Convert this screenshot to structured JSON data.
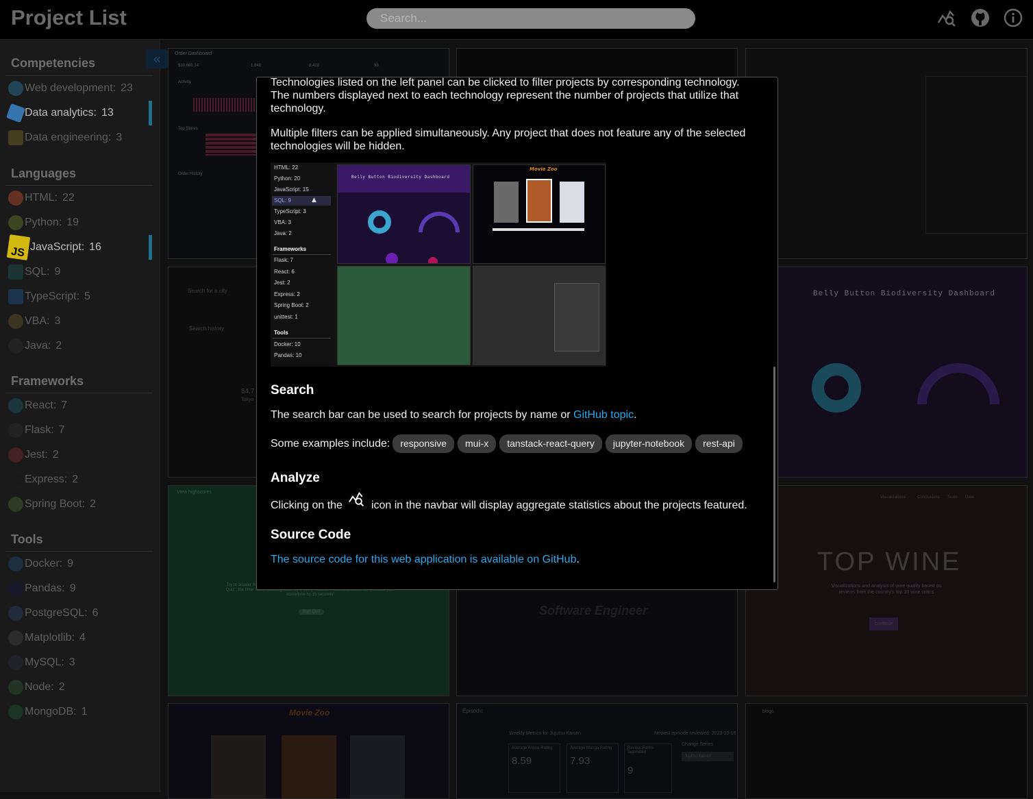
{
  "header": {
    "title": "Project List",
    "search_placeholder": "Search...",
    "icons": [
      "analytics-icon",
      "github-icon",
      "info-icon"
    ]
  },
  "sidebar": {
    "collapse_icon": "double-chevron-left-icon",
    "sections": [
      {
        "title": "Competencies",
        "items": [
          {
            "label": "Web development:",
            "count": "23"
          },
          {
            "label": "Data analytics:",
            "count": "13",
            "active": true
          },
          {
            "label": "Data engineering:",
            "count": "3"
          }
        ]
      },
      {
        "title": "Languages",
        "items": [
          {
            "label": "HTML:",
            "count": "22"
          },
          {
            "label": "Python:",
            "count": "19"
          },
          {
            "label": "JavaScript:",
            "count": "16",
            "active": true
          },
          {
            "label": "SQL:",
            "count": "9"
          },
          {
            "label": "TypeScript:",
            "count": "5"
          },
          {
            "label": "VBA:",
            "count": "3"
          },
          {
            "label": "Java:",
            "count": "2"
          }
        ]
      },
      {
        "title": "Frameworks",
        "items": [
          {
            "label": "React:",
            "count": "7"
          },
          {
            "label": "Flask:",
            "count": "7"
          },
          {
            "label": "Jest:",
            "count": "2"
          },
          {
            "label": "Express:",
            "count": "2"
          },
          {
            "label": "Spring Boot:",
            "count": "2"
          }
        ]
      },
      {
        "title": "Tools",
        "items": [
          {
            "label": "Docker:",
            "count": "9"
          },
          {
            "label": "Pandas:",
            "count": "9"
          },
          {
            "label": "PostgreSQL:",
            "count": "6"
          },
          {
            "label": "Matplotlib:",
            "count": "4"
          },
          {
            "label": "MySQL:",
            "count": "3"
          },
          {
            "label": "Node:",
            "count": "2"
          },
          {
            "label": "MongoDB:",
            "count": "1"
          }
        ]
      }
    ]
  },
  "cards": {
    "order_dashboard": {
      "title": "Order Dashboard",
      "stats": [
        "$10,681.14",
        "1,848",
        "8,422",
        "93"
      ],
      "labels": [
        "Activity",
        "Top Stores",
        "Order History"
      ]
    },
    "weather": {
      "search_label": "Search for a city",
      "history_label": "Search history",
      "temp": "54.7",
      "city": "Tokyo"
    },
    "belly": {
      "title": "Belly Button Biodiversity Dashboard"
    },
    "quiz": {
      "link": "View highscores",
      "text": "Try to answer the following code-related questions within the time limit. Upon pressing \"Start Quiz\", the timer starts counting down by 1 every second. Incorrect answers will penalize your score/time by 15 seconds!",
      "button": "Start Quiz"
    },
    "wine": {
      "title": "TOP WINE",
      "subtitle": "Visualizations and analysis of wine quality based on reviews from the country's top 10 wine critics",
      "button": "continue",
      "nav": [
        "Visualizations",
        "Conclusions",
        "Team",
        "Data"
      ]
    },
    "engineer": {
      "title": "Software Engineer"
    },
    "movies": {
      "title": "Movie Zoo"
    },
    "episodic": {
      "title": "Episodic",
      "metrics_title": "Weekly Metrics for Jujutsu Kaisen",
      "newest": "Newest episode reviewed: 2023-10-16",
      "m1_label": "Average Anime Rating",
      "m1": "8.59",
      "m2_label": "Average Manga Rating",
      "m2": "7.93",
      "m3_label": "Review Forms Submitted",
      "m3": "9",
      "change": "Change Series",
      "select": "Jujutsu Kaisen"
    },
    "blogs": {
      "title": "blogs"
    }
  },
  "modal": {
    "intro1": "Technologies listed on the left panel can be clicked to filter projects by corresponding technology. The numbers displayed next to each technology represent the number of projects that utilize that technology.",
    "intro2": "Multiple filters can be applied simultaneously. Any project that does not feature any of the selected technologies will be hidden.",
    "demo": {
      "languages": [
        "HTML: 22",
        "Python: 20",
        "JavaScript: 15",
        "SQL: 9",
        "TypeScript: 3",
        "VBA: 3",
        "Java: 2"
      ],
      "frameworks_title": "Frameworks",
      "frameworks": [
        "Flask: 7",
        "React: 6",
        "Jest: 2",
        "Express: 2",
        "Spring Boot: 2",
        "unittest: 1"
      ],
      "tools_title": "Tools",
      "tools": [
        "Docker: 10",
        "Pandas: 10"
      ],
      "belly_title": "Belly Button Biodiversity Dashboard",
      "movie_title": "Movie Zoo"
    },
    "search_heading": "Search",
    "search_text_before": "The search bar can be used to search for projects by name or ",
    "search_link": "GitHub topic",
    "search_text_after": ".",
    "examples_label": "Some examples include:",
    "examples": [
      "responsive",
      "mui-x",
      "tanstack-react-query",
      "jupyter-notebook",
      "rest-api"
    ],
    "analyze_heading": "Analyze",
    "analyze_before": "Clicking on the",
    "analyze_after": "icon in the navbar will display aggregate statistics about the projects featured.",
    "source_heading": "Source Code",
    "source_link": "The source code for this web application is available on GitHub",
    "source_after": "."
  }
}
